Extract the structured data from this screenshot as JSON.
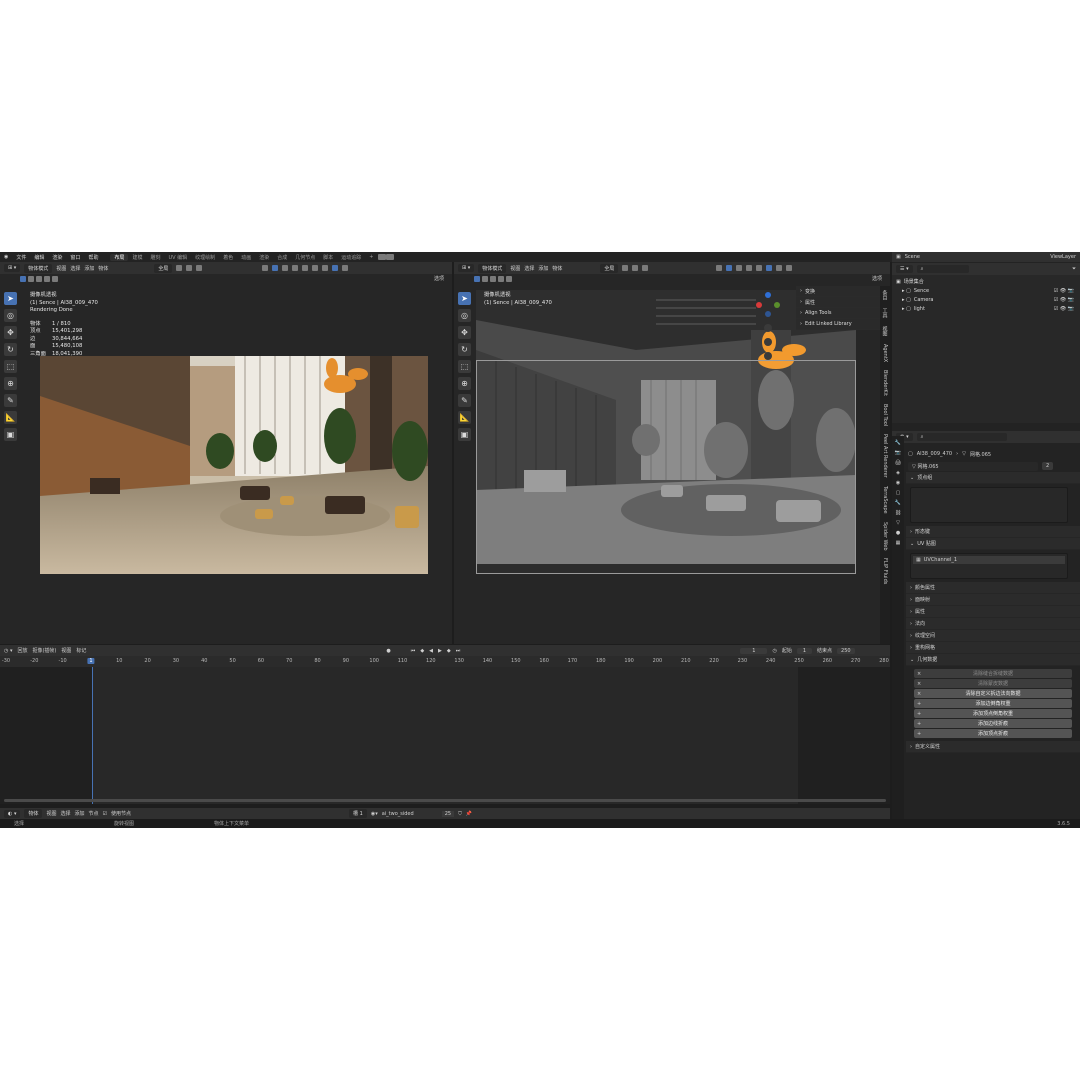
{
  "menu": {
    "items": [
      "文件",
      "编辑",
      "渲染",
      "窗口",
      "帮助"
    ],
    "workspaces": [
      "布局",
      "建模",
      "雕刻",
      "UV 编辑",
      "纹理绘制",
      "着色",
      "动画",
      "渲染",
      "合成",
      "几何节点",
      "脚本",
      "运动追踪"
    ],
    "active_workspace": "布局",
    "add_tab": "+"
  },
  "left_view": {
    "mode": "物体模式",
    "menus": [
      "视图",
      "选择",
      "添加",
      "物体"
    ],
    "transform": "全局",
    "options": "选项",
    "info_title": "摄像机透视",
    "info_scene": "(1) Sence | AI38_009_470",
    "info_status": "Rendering Done",
    "stats": [
      {
        "label": "物体",
        "value": "1 / 810"
      },
      {
        "label": "顶点",
        "value": "15,401,298"
      },
      {
        "label": "边",
        "value": "30,844,664"
      },
      {
        "label": "面",
        "value": "15,480,108"
      },
      {
        "label": "三角面",
        "value": "18,041,390"
      }
    ]
  },
  "right_view": {
    "mode": "物体模式",
    "menus": [
      "视图",
      "选择",
      "添加",
      "物体"
    ],
    "transform": "全局",
    "options": "选项",
    "info_title": "摄像机透视",
    "info_scene": "(1) Sence | AI38_009_470",
    "npanel": [
      "变换",
      "属性",
      "Align Tools",
      "Edit Linked Library"
    ],
    "side_tabs": [
      "条目",
      "工具",
      "视图",
      "AgentX",
      "BlenderKit",
      "Bool Tool",
      "Peel Art Renderer",
      "TerraScape",
      "Spider Web",
      "FLIP Fluids"
    ]
  },
  "timeline": {
    "menus": [
      "回放",
      "抠像(插帧)",
      "视图",
      "标记"
    ],
    "current_frame": "1",
    "start_label": "起始",
    "start": "1",
    "end_label": "结束点",
    "end": "250",
    "ticks": [
      "-30",
      "-20",
      "-10",
      "1",
      "10",
      "20",
      "30",
      "40",
      "50",
      "60",
      "70",
      "80",
      "90",
      "100",
      "110",
      "120",
      "130",
      "140",
      "150",
      "160",
      "170",
      "180",
      "190",
      "200",
      "210",
      "220",
      "230",
      "240",
      "250",
      "260",
      "270",
      "280"
    ]
  },
  "shader_bar": {
    "mode": "物体",
    "menus": [
      "视图",
      "选择",
      "添加",
      "节点"
    ],
    "use_nodes": "使用节点",
    "slot": "槽 1",
    "material": "ai_two_sided",
    "users": "25"
  },
  "status_bar": {
    "select": "选择",
    "rotate": "旋转视图",
    "context": "物体上下文菜单",
    "version": "3.6.5"
  },
  "outliner": {
    "root": "场景集合",
    "items": [
      "Sence",
      "Camera",
      "light"
    ],
    "scene_label": "Scene",
    "viewlayer_label": "ViewLayer"
  },
  "properties": {
    "object_path": "AI38_009_470",
    "mesh_path": "网格.065",
    "mesh_name": "网格.065",
    "users": "2",
    "sections": [
      "顶点组",
      "形态键",
      "UV 贴图"
    ],
    "uv_channel": "UVChannel_1",
    "sections2": [
      "颜色属性",
      "面映射",
      "属性",
      "法向",
      "纹理空间",
      "重构网格",
      "几何数据"
    ],
    "geo_buttons": [
      {
        "label": "清除缝合拆缝数据",
        "dim": true
      },
      {
        "label": "清除蒙皮数据",
        "dim": true
      },
      {
        "label": "清除自定义拆边法向数据",
        "dim": false
      },
      {
        "label": "添加边倒角权重",
        "dim": false
      },
      {
        "label": "添加顶点倒角权重",
        "dim": false
      },
      {
        "label": "添加边线折痕",
        "dim": false
      },
      {
        "label": "添加顶点折痕",
        "dim": false
      }
    ],
    "custom_props": "自定义属性"
  },
  "colors": {
    "accent": "#4772b3",
    "panel": "#303030",
    "background": "#1d1d1d",
    "viewport": "#262626"
  },
  "icons": [
    "blender-icon",
    "select-box-icon",
    "cursor-icon",
    "move-icon",
    "rotate-icon",
    "scale-icon",
    "transform-icon",
    "annotate-icon",
    "measure-icon",
    "add-cube-icon",
    "play-icon",
    "camera-icon",
    "hand-icon",
    "zoom-icon"
  ]
}
